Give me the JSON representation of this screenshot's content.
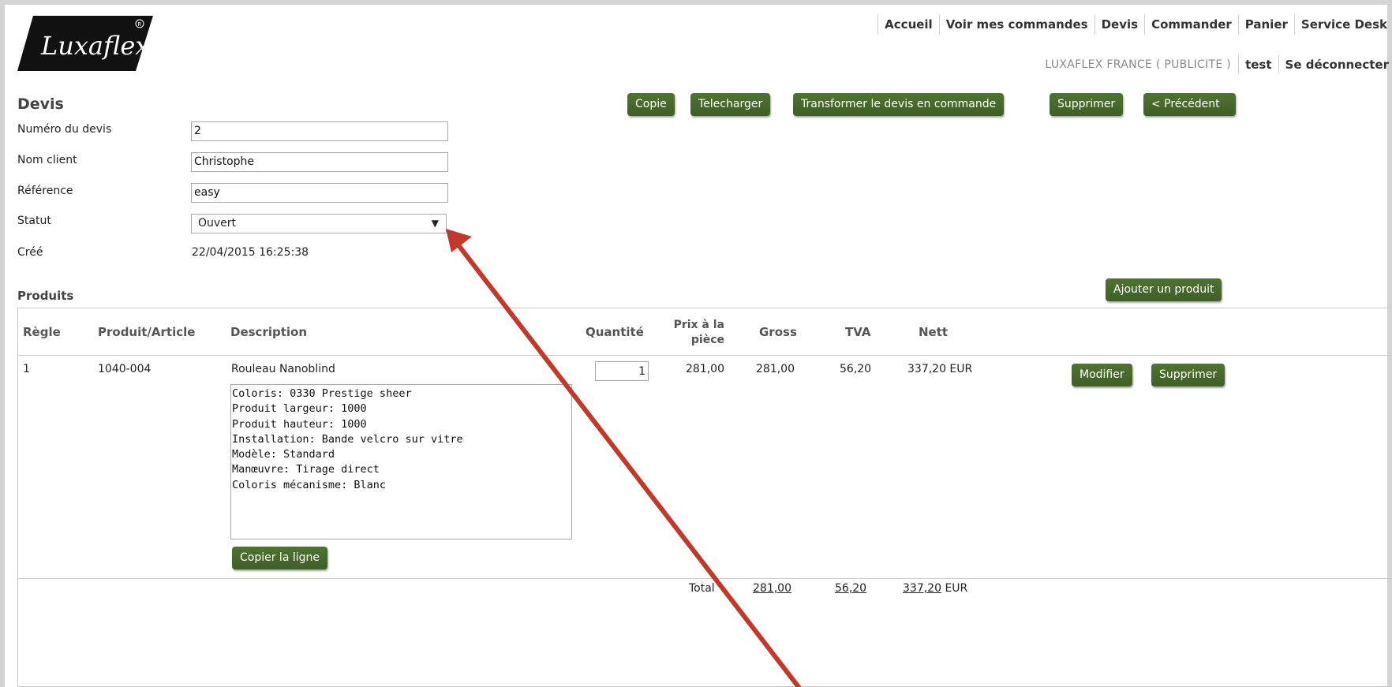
{
  "top_nav": [
    "Accueil",
    "Voir mes commandes",
    "Devis",
    "Commander",
    "Panier",
    "Service Desk"
  ],
  "user_nav": {
    "company": "LUXAFLEX FRANCE ( PUBLICITE )",
    "user": "test",
    "logout": "Se déconnecter"
  },
  "logo_text": "Luxaflex",
  "page_title": "Devis",
  "actions": {
    "copy": "Copie",
    "download": "Telecharger",
    "convert": "Transformer le devis en commande",
    "delete": "Supprimer",
    "previous": "< Précédent"
  },
  "form": {
    "quote_number_label": "Numéro du devis",
    "quote_number_value": "2",
    "client_name_label": "Nom client",
    "client_name_value": "Christophe",
    "reference_label": "Référence",
    "reference_value": "easy",
    "status_label": "Statut",
    "status_value": "Ouvert",
    "created_label": "Créé",
    "created_value": "22/04/2015 16:25:38"
  },
  "products": {
    "title": "Produits",
    "add_button": "Ajouter un produit",
    "columns": {
      "rule": "Règle",
      "product": "Produit/Article",
      "description": "Description",
      "quantity": "Quantité",
      "unit_price": [
        "Prix à la",
        "pièce"
      ],
      "gross": "Gross",
      "vat": "TVA",
      "net": "Nett"
    },
    "rows": [
      {
        "rule": "1",
        "product": "1040-004",
        "name": "Rouleau Nanoblind",
        "details": [
          "Coloris: 0330 Prestige sheer",
          "Produit largeur: 1000",
          "Produit hauteur: 1000",
          "Installation: Bande velcro sur vitre",
          "Modèle: Standard",
          "Manœuvre: Tirage direct",
          "Coloris mécanisme: Blanc"
        ],
        "quantity": "1",
        "unit_price": "281,00",
        "gross": "281,00",
        "vat": "56,20",
        "net": "337,20 EUR",
        "edit_button": "Modifier",
        "delete_button": "Supprimer",
        "copy_line_button": "Copier la ligne"
      }
    ],
    "totals": {
      "label": "Total",
      "gross": "281,00",
      "vat": "56,20",
      "net": "337,20",
      "currency": "EUR"
    }
  },
  "colors": {
    "button_green": "#4a6b2e",
    "annotation_arrow": "#c0392b"
  }
}
